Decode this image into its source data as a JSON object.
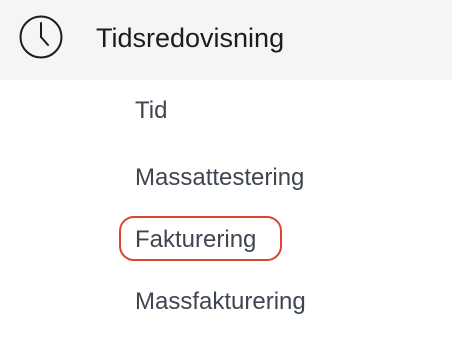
{
  "section": {
    "title": "Tidsredovisning",
    "icon": "clock-icon"
  },
  "nav": {
    "items": [
      {
        "label": "Tid"
      },
      {
        "label": "Massattestering"
      },
      {
        "label": "Fakturering",
        "highlighted": true
      },
      {
        "label": "Massfakturering"
      }
    ]
  },
  "colors": {
    "header_background": "#f5f5f5",
    "title_text": "#1c1c1c",
    "item_text": "#3f4650",
    "highlight_ring": "#d9472b"
  }
}
